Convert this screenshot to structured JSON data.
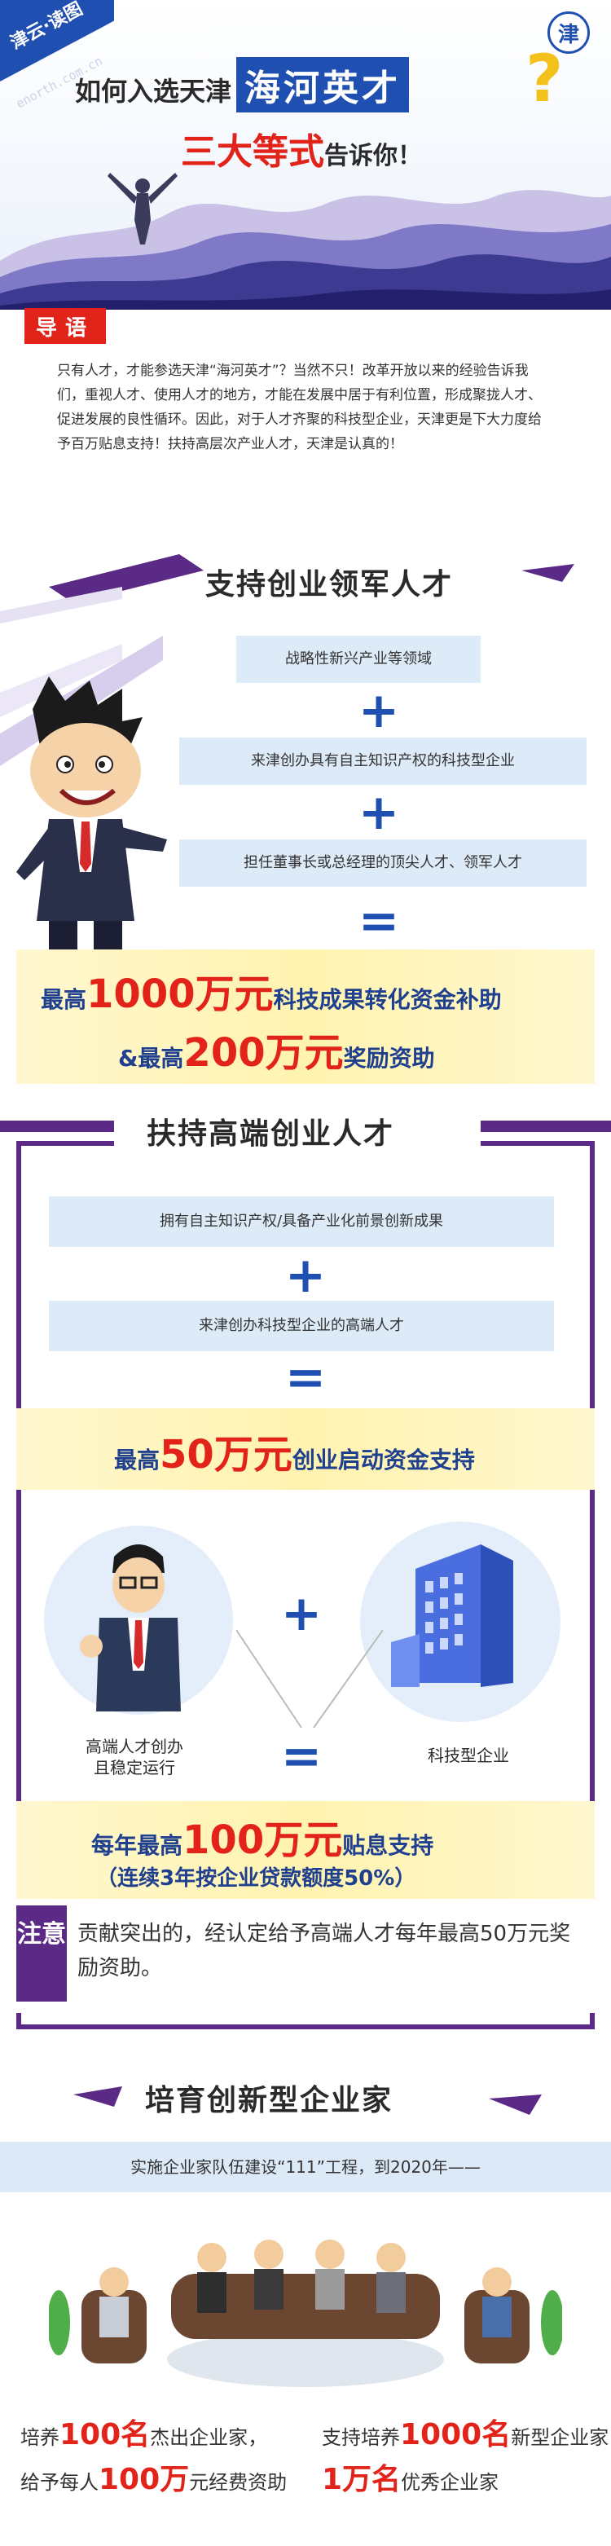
{
  "header": {
    "brand": "津云·读图",
    "brand_sub": "enorth.com.cn",
    "logo": "津",
    "title_prefix": "如何入选天津",
    "title_highlight": "海河英才",
    "title_question": "?",
    "subtitle_main": "三大等式",
    "subtitle_tail": "告诉你！"
  },
  "intro": {
    "badge": "导语",
    "text": "只有人才，才能参选天津“海河英才”？当然不只！改革开放以来的经验告诉我们，重视人才、使用人才的地方，才能在发展中居于有利位置，形成聚拢人才、促进发展的良性循环。因此，对于人才齐聚的科技型企业，天津更是下大力度给予百万贴息支持！扶持高层次产业人才，天津是认真的！"
  },
  "section1": {
    "title": "支持创业领军人才",
    "cond1": "战略性新兴产业等领域",
    "cond2": "来津创办具有自主知识产权的科技型企业",
    "cond3": "担任董事长或总经理的顶尖人才、领军人才",
    "plus": "+",
    "equals": "=",
    "result1_pre": "最高",
    "result1_big": "1000万元",
    "result1_post": "科技成果转化资金补助",
    "result2_pre": "&最高",
    "result2_big": "200万元",
    "result2_post": "奖励资助"
  },
  "section2": {
    "title": "扶持高端创业人才",
    "cond1": "拥有自主知识产权/具备产业化前景创新成果",
    "cond2": "来津创办科技型企业的高端人才",
    "result_pre": "最高",
    "result_big": "50万元",
    "result_post": "创业启动资金支持",
    "left_label": "高端人才创办\n且稳定运行",
    "right_label": "科技型企业",
    "result2_pre": "每年最高",
    "result2_big": "100万元",
    "result2_post": "贴息支持",
    "result2_note": "（连续3年按企业贷款额度50%）"
  },
  "notice": {
    "label": "注意",
    "text": "贡献突出的，经认定给予高端人才每年最高50万元奖励资助。"
  },
  "section3": {
    "title": "培育创新型企业家",
    "subtitle": "实施企业家队伍建设“111”工程，到2020年——",
    "left_l1_pre": "培养",
    "left_l1_big": "100名",
    "left_l1_post": "杰出企业家，",
    "left_l2_pre": "给予每人",
    "left_l2_big": "100万",
    "left_l2_post": "元经费资助",
    "right_l1_pre": "支持培养",
    "right_l1_big": "1000名",
    "right_l1_post": "新型企业家",
    "right_l2_big": "1万名",
    "right_l2_post": "优秀企业家"
  },
  "colors": {
    "brand_blue": "#1f4fb0",
    "accent_red": "#e2231a",
    "purple": "#5b2a86",
    "light_blue_box": "#ddeaf7",
    "yellow_bar": "#fff3b0"
  }
}
